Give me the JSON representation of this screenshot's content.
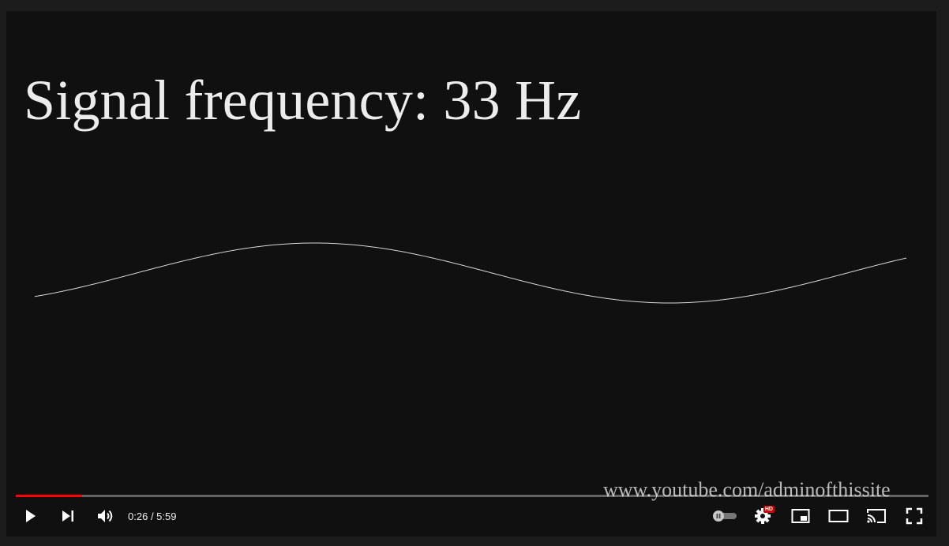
{
  "video": {
    "title_text": "Signal frequency: 33 Hz",
    "watermark": "www.youtube.com/adminofthissite"
  },
  "player": {
    "progress": {
      "played_fraction": 0.073,
      "played_color": "#ff0000"
    },
    "time": {
      "current": "0:26",
      "duration": "5:59"
    },
    "hd_badge": "HD"
  },
  "icons": [
    "play-icon",
    "next-icon",
    "volume-icon",
    "autoplay-toggle-icon",
    "settings-icon",
    "miniplayer-icon",
    "theater-mode-icon",
    "cast-icon",
    "fullscreen-icon"
  ]
}
